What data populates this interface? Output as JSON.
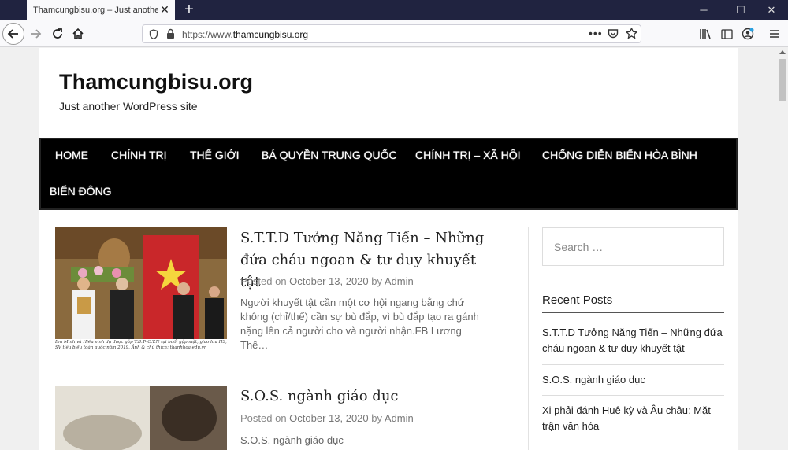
{
  "browser": {
    "tab_title": "Thamcungbisu.org – Just another WordPress site",
    "url_scheme": "https://www.",
    "url_host": "thamcungbisu.org",
    "window_controls": [
      "minimize-icon",
      "maximize-icon",
      "close-icon"
    ]
  },
  "site": {
    "title": "Thamcungbisu.org",
    "description": "Just another WordPress site"
  },
  "menu": [
    "HOME",
    "CHÍNH TRỊ",
    "THẾ GIỚI",
    "BÁ QUYỀN TRUNG QUỐC",
    "CHÍNH TRỊ – XÃ HỘI",
    "CHỐNG DIỄN BIẾN HÒA BÌNH",
    "BIỂN ĐÔNG"
  ],
  "posts": [
    {
      "title": "S.T.T.D Tưởng Năng Tiến – Những đứa cháu ngoan & tư duy khuyết tật",
      "meta_prefix": "Posted on",
      "date": "October 13, 2020",
      "meta_by": "by",
      "author": "Admin",
      "excerpt": "Người khuyết tật cần một cơ hội ngang bằng chứ không (chỉ/thể) cần sự bù đắp, vì bù đắp tạo ra gánh nặng lên cả người cho và người nhận.FB Lương Thế…",
      "image_caption": "Em Minh và Hiếu vinh dự được gặp T.B.T- C.T.N tại buổi gặp mặt, giao lưu HS, SV tiêu biểu toàn quốc năm 2019. Ảnh & chú thích: thanhhoa.edu.vn"
    },
    {
      "title": "S.O.S. ngành giáo dục",
      "meta_prefix": "Posted on",
      "date": "October 13, 2020",
      "meta_by": "by",
      "author": "Admin",
      "excerpt": "S.O.S. ngành giáo dục"
    }
  ],
  "sidebar": {
    "search_placeholder": "Search …",
    "recent_title": "Recent Posts",
    "recent_posts": [
      "S.T.T.D Tưởng Năng Tiến – Những đứa cháu ngoan & tư duy khuyết tật",
      "S.O.S. ngành giáo dục",
      "Xi phải đánh Huê kỳ và Âu châu: Mặt trận văn hóa"
    ]
  },
  "colors": {
    "nav_bg": "#000000",
    "tab_bar": "#202340",
    "accent_link": "#222222"
  }
}
